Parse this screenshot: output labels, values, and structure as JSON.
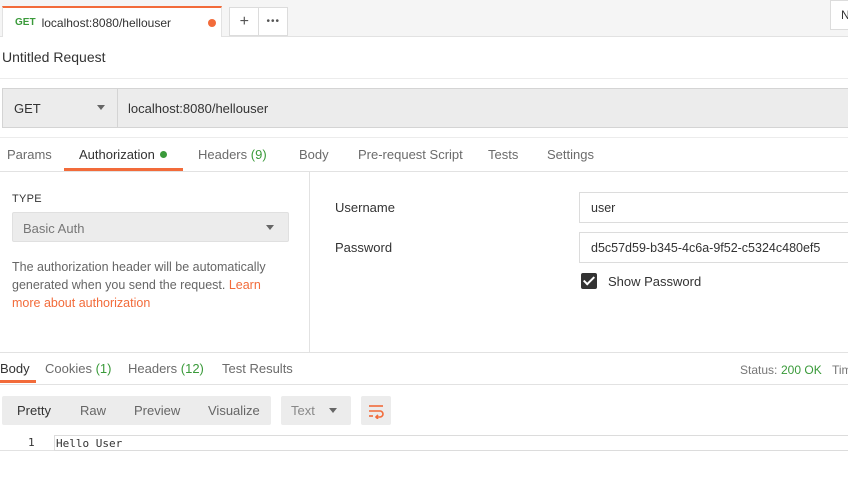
{
  "request_tab": {
    "method": "GET",
    "url": "localhost:8080/hellouser"
  },
  "tab_actions": {
    "new_tab": "+",
    "more": "•••"
  },
  "environment_label": "N",
  "request": {
    "title": "Untitled Request",
    "method": "GET",
    "url": "localhost:8080/hellouser"
  },
  "request_tabs": [
    {
      "label": "Params",
      "count": ""
    },
    {
      "label": "Authorization",
      "count": ""
    },
    {
      "label": "Headers",
      "count": "(9)"
    },
    {
      "label": "Body",
      "count": ""
    },
    {
      "label": "Pre-request Script",
      "count": ""
    },
    {
      "label": "Tests",
      "count": ""
    },
    {
      "label": "Settings",
      "count": ""
    }
  ],
  "auth": {
    "type_label": "TYPE",
    "type_value": "Basic Auth",
    "description": "The authorization header will be automatically generated when you send the request. ",
    "link_text": "Learn more about authorization",
    "username_label": "Username",
    "username_value": "user",
    "password_label": "Password",
    "password_value": "d5c57d59-b345-4c6a-9f52-c5324c480ef5",
    "show_password_label": "Show Password",
    "show_password_checked": true
  },
  "response_tabs": [
    {
      "label": "Body",
      "count": ""
    },
    {
      "label": "Cookies",
      "count": "(1)"
    },
    {
      "label": "Headers",
      "count": "(12)"
    },
    {
      "label": "Test Results",
      "count": ""
    }
  ],
  "status": {
    "label": "Status:",
    "value": "200 OK",
    "time_label": "Tim"
  },
  "view_modes": [
    "Pretty",
    "Raw",
    "Preview",
    "Visualize"
  ],
  "format": "Text",
  "response_body": {
    "line_number": "1",
    "text": "Hello User"
  },
  "colors": {
    "accent": "#f26b3a",
    "success": "#3a9a3a"
  }
}
